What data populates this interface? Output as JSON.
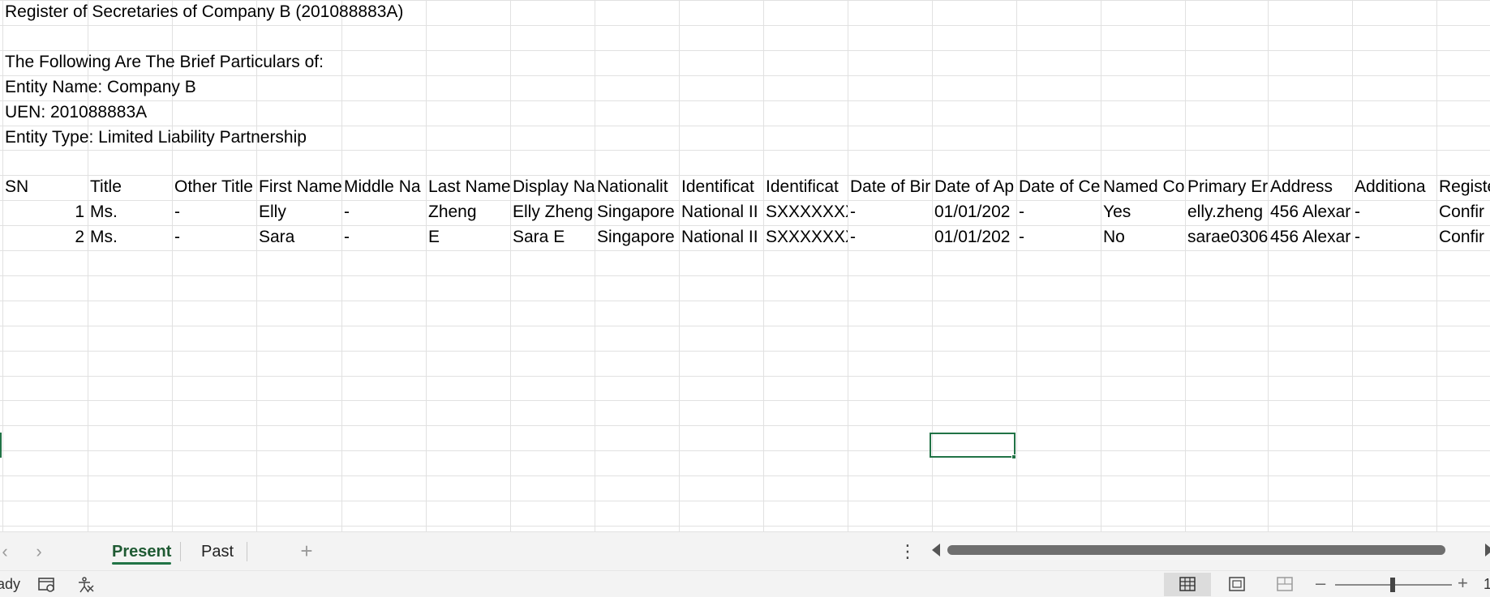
{
  "sheet": {
    "info_lines": [
      "Register of Secretaries of Company B (201088883A)",
      "",
      "The Following Are The Brief Particulars of:",
      "Entity Name: Company B",
      "UEN: 201088883A",
      "Entity Type: Limited Liability Partnership"
    ],
    "headers": [
      "SN",
      "Title",
      "Other Title",
      "First Name",
      "Middle Na",
      "Last Name",
      "Display Na",
      "Nationalit",
      "Identificat",
      "Identificat",
      "Date of Bir",
      "Date of Ap",
      "Date of Ce",
      "Named Co",
      "Primary Er",
      "Address",
      "Additiona",
      "Registe"
    ],
    "rows": [
      [
        "1",
        "Ms.",
        "-",
        "Elly",
        "-",
        "Zheng",
        "Elly Zheng",
        "Singapore",
        "National II",
        "SXXXXXXX",
        "-",
        "01/01/202",
        "-",
        "Yes",
        "elly.zheng",
        "456 Alexar",
        "-",
        "Confir"
      ],
      [
        "2",
        "Ms.",
        "-",
        "Sara",
        "-",
        "E",
        "Sara E",
        "Singapore",
        "National II",
        "SXXXXXXX",
        "-",
        "01/01/202",
        "-",
        "No",
        "sarae0306",
        "456 Alexar",
        "-",
        "Confir"
      ]
    ]
  },
  "tabs": {
    "sheets": [
      "Present",
      "Past"
    ],
    "active": "Present",
    "prev_icon": "chevron-left-icon",
    "next_icon": "chevron-right-icon",
    "add_icon": "plus-icon",
    "options_icon": "vertical-ellipsis-icon"
  },
  "status": {
    "text": "ady",
    "zoom_label": "1"
  },
  "colors": {
    "accent": "#217346",
    "gridline": "#e1e1e1",
    "chrome": "#f3f3f3"
  }
}
